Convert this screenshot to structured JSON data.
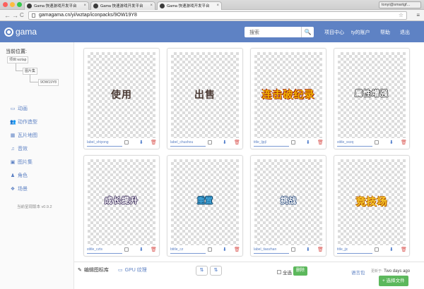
{
  "browser": {
    "tabs": [
      {
        "title": "Gama 快速游戏开发平台"
      },
      {
        "title": "Gama 快速游戏开发平台"
      },
      {
        "title": "Gama 快速游戏开发平台"
      }
    ],
    "tab_close": "×",
    "user": "tonyi@smartgf...",
    "back": "←",
    "forward": "→",
    "reload": "C",
    "url": "gamagama.cn/yi/wztap/iconpacks/9OW19Y8",
    "star": "☆",
    "menu": "≡",
    "traffic_colors": [
      "#fc605c",
      "#fdbc40",
      "#34c84a"
    ]
  },
  "header": {
    "logo_text": "gama",
    "search_placeholder": "搜索",
    "search_icon": "🔍",
    "nav": [
      "项目中心",
      "ty的账户",
      "帮助",
      "退出"
    ],
    "accent": "#5e82c4"
  },
  "sidebar": {
    "location_title": "当前位置:",
    "breadcrumbs": [
      "项目:wztap",
      "图片集",
      "9OW19Y8"
    ],
    "items": [
      {
        "icon": "film-icon",
        "glyph": "▭",
        "label": "动画"
      },
      {
        "icon": "people-icon",
        "glyph": "👥",
        "label": "动作造型"
      },
      {
        "icon": "grid-icon",
        "glyph": "▦",
        "label": "瓦片地图"
      },
      {
        "icon": "music-icon",
        "glyph": "♫",
        "label": "音效"
      },
      {
        "icon": "image-icon",
        "glyph": "▣",
        "label": "图片集"
      },
      {
        "icon": "person-icon",
        "glyph": "♟",
        "label": "角色"
      },
      {
        "icon": "scene-icon",
        "glyph": "❖",
        "label": "场景"
      }
    ],
    "version": "当前呈现版本 v0.9.2"
  },
  "cards": [
    {
      "art": "使用",
      "name": "label_shiyong",
      "style": "a1"
    },
    {
      "art": "出售",
      "name": "label_chushou",
      "style": "a2"
    },
    {
      "art": "连击破纪录",
      "name": "title_ljpjl",
      "style": "a3"
    },
    {
      "art": "属性增强",
      "name": "stitle_sxzq",
      "style": "a4"
    },
    {
      "art": "成长提升",
      "name": "stitle_czts",
      "style": "a5"
    },
    {
      "art": "重置",
      "name": "btitle_cz",
      "style": "a6"
    },
    {
      "art": "挑战",
      "name": "label_tiaozhan",
      "style": "a7"
    },
    {
      "art": "竞技场",
      "name": "title_jjc",
      "style": "a8"
    }
  ],
  "card_icons": {
    "download": "⬇",
    "delete": "🗑"
  },
  "bottombar": {
    "tab_edit_icon": "✎",
    "tab_edit": "编辑图标库",
    "tab_gpu_icon": "▭",
    "tab_gpu": "GPU 纹理",
    "sort_asc": "⇅",
    "sort_desc": "⇅",
    "select_all": "全选",
    "delete": "删除",
    "language_pack": "语言包",
    "updated_label": "更新于:",
    "updated_value": "Two days ago",
    "choose_file": "+ 选择文件"
  }
}
